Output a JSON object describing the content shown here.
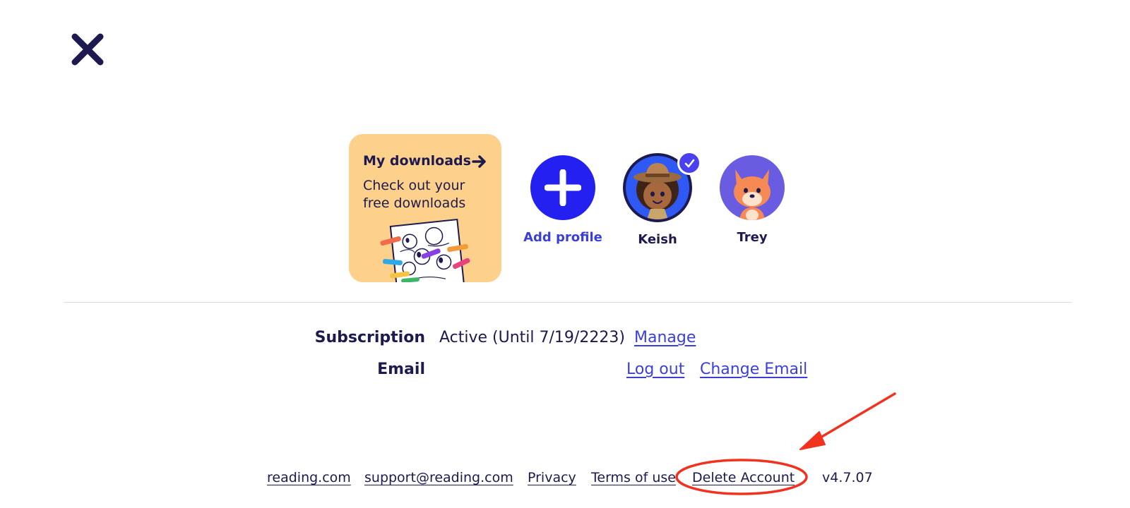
{
  "downloads": {
    "title": "My downloads",
    "subtitle": "Check out your free downloads"
  },
  "profiles": [
    {
      "label": "Add profile",
      "icon": "plus-icon",
      "color": "#2420f0"
    },
    {
      "label": "Keish",
      "selected": true,
      "avatar": "ranger-girl-avatar",
      "color": "#2f59f5"
    },
    {
      "label": "Trey",
      "avatar": "fox-avatar",
      "color": "#6a5ce0"
    }
  ],
  "account": {
    "subscription_label": "Subscription",
    "subscription_value": "Active (Until 7/19/2223)",
    "manage_link": "Manage",
    "email_label": "Email",
    "logout_link": "Log out",
    "change_email_link": "Change Email"
  },
  "footer": {
    "site": "reading.com",
    "support": "support@reading.com",
    "privacy": "Privacy",
    "terms": "Terms of use",
    "delete": "Delete Account",
    "version": "v4.7.07"
  },
  "colors": {
    "navy": "#1c1a4e",
    "link": "#3b3fd9",
    "accent_blue": "#2420f0",
    "card": "#fdd08b",
    "annotation_red": "#f0321e"
  }
}
